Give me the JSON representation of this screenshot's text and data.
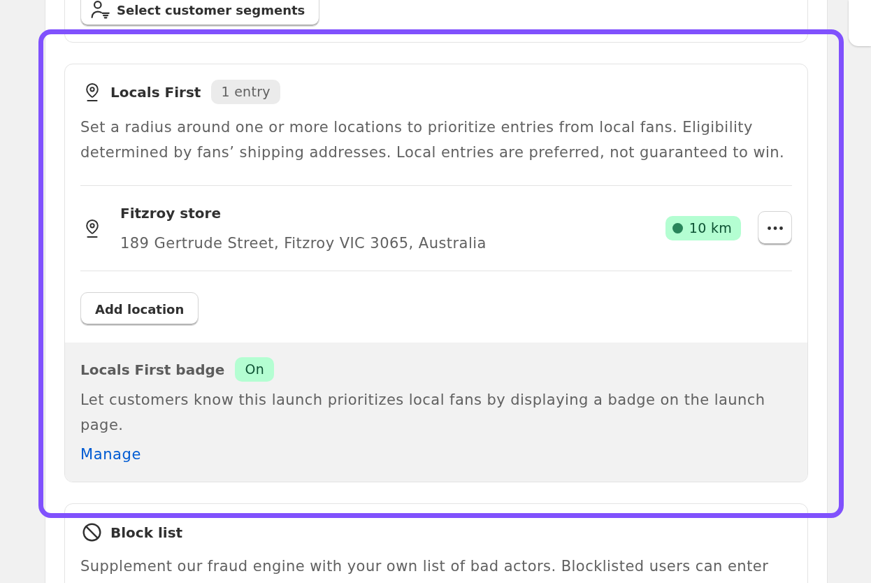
{
  "segments_card": {
    "button": "Select customer segments"
  },
  "locals_first": {
    "highlighted": true,
    "title": "Locals First",
    "badge": {
      "text": "1 entry"
    },
    "description": "Set a radius around one or more locations to prioritize entries from local fans. Eligibility determined by fans’ shipping addresses. Local entries are preferred, not guaranteed to win.",
    "locations": [
      {
        "name": "Fitzroy store",
        "address": "189 Gertrude Street, Fitzroy VIC 3065, Australia",
        "radius": {
          "text": "10 km",
          "dot": true
        }
      }
    ],
    "add_button": "Add location",
    "badge_section": {
      "title": "Locals First badge",
      "status": {
        "text": "On"
      },
      "description": "Let customers know this launch prioritizes local fans by displaying a badge on the launch page.",
      "link": "Manage"
    }
  },
  "block_list": {
    "title": "Block list",
    "description": "Supplement our fraud engine with your own list of bad actors. Blocklisted users can enter"
  }
}
